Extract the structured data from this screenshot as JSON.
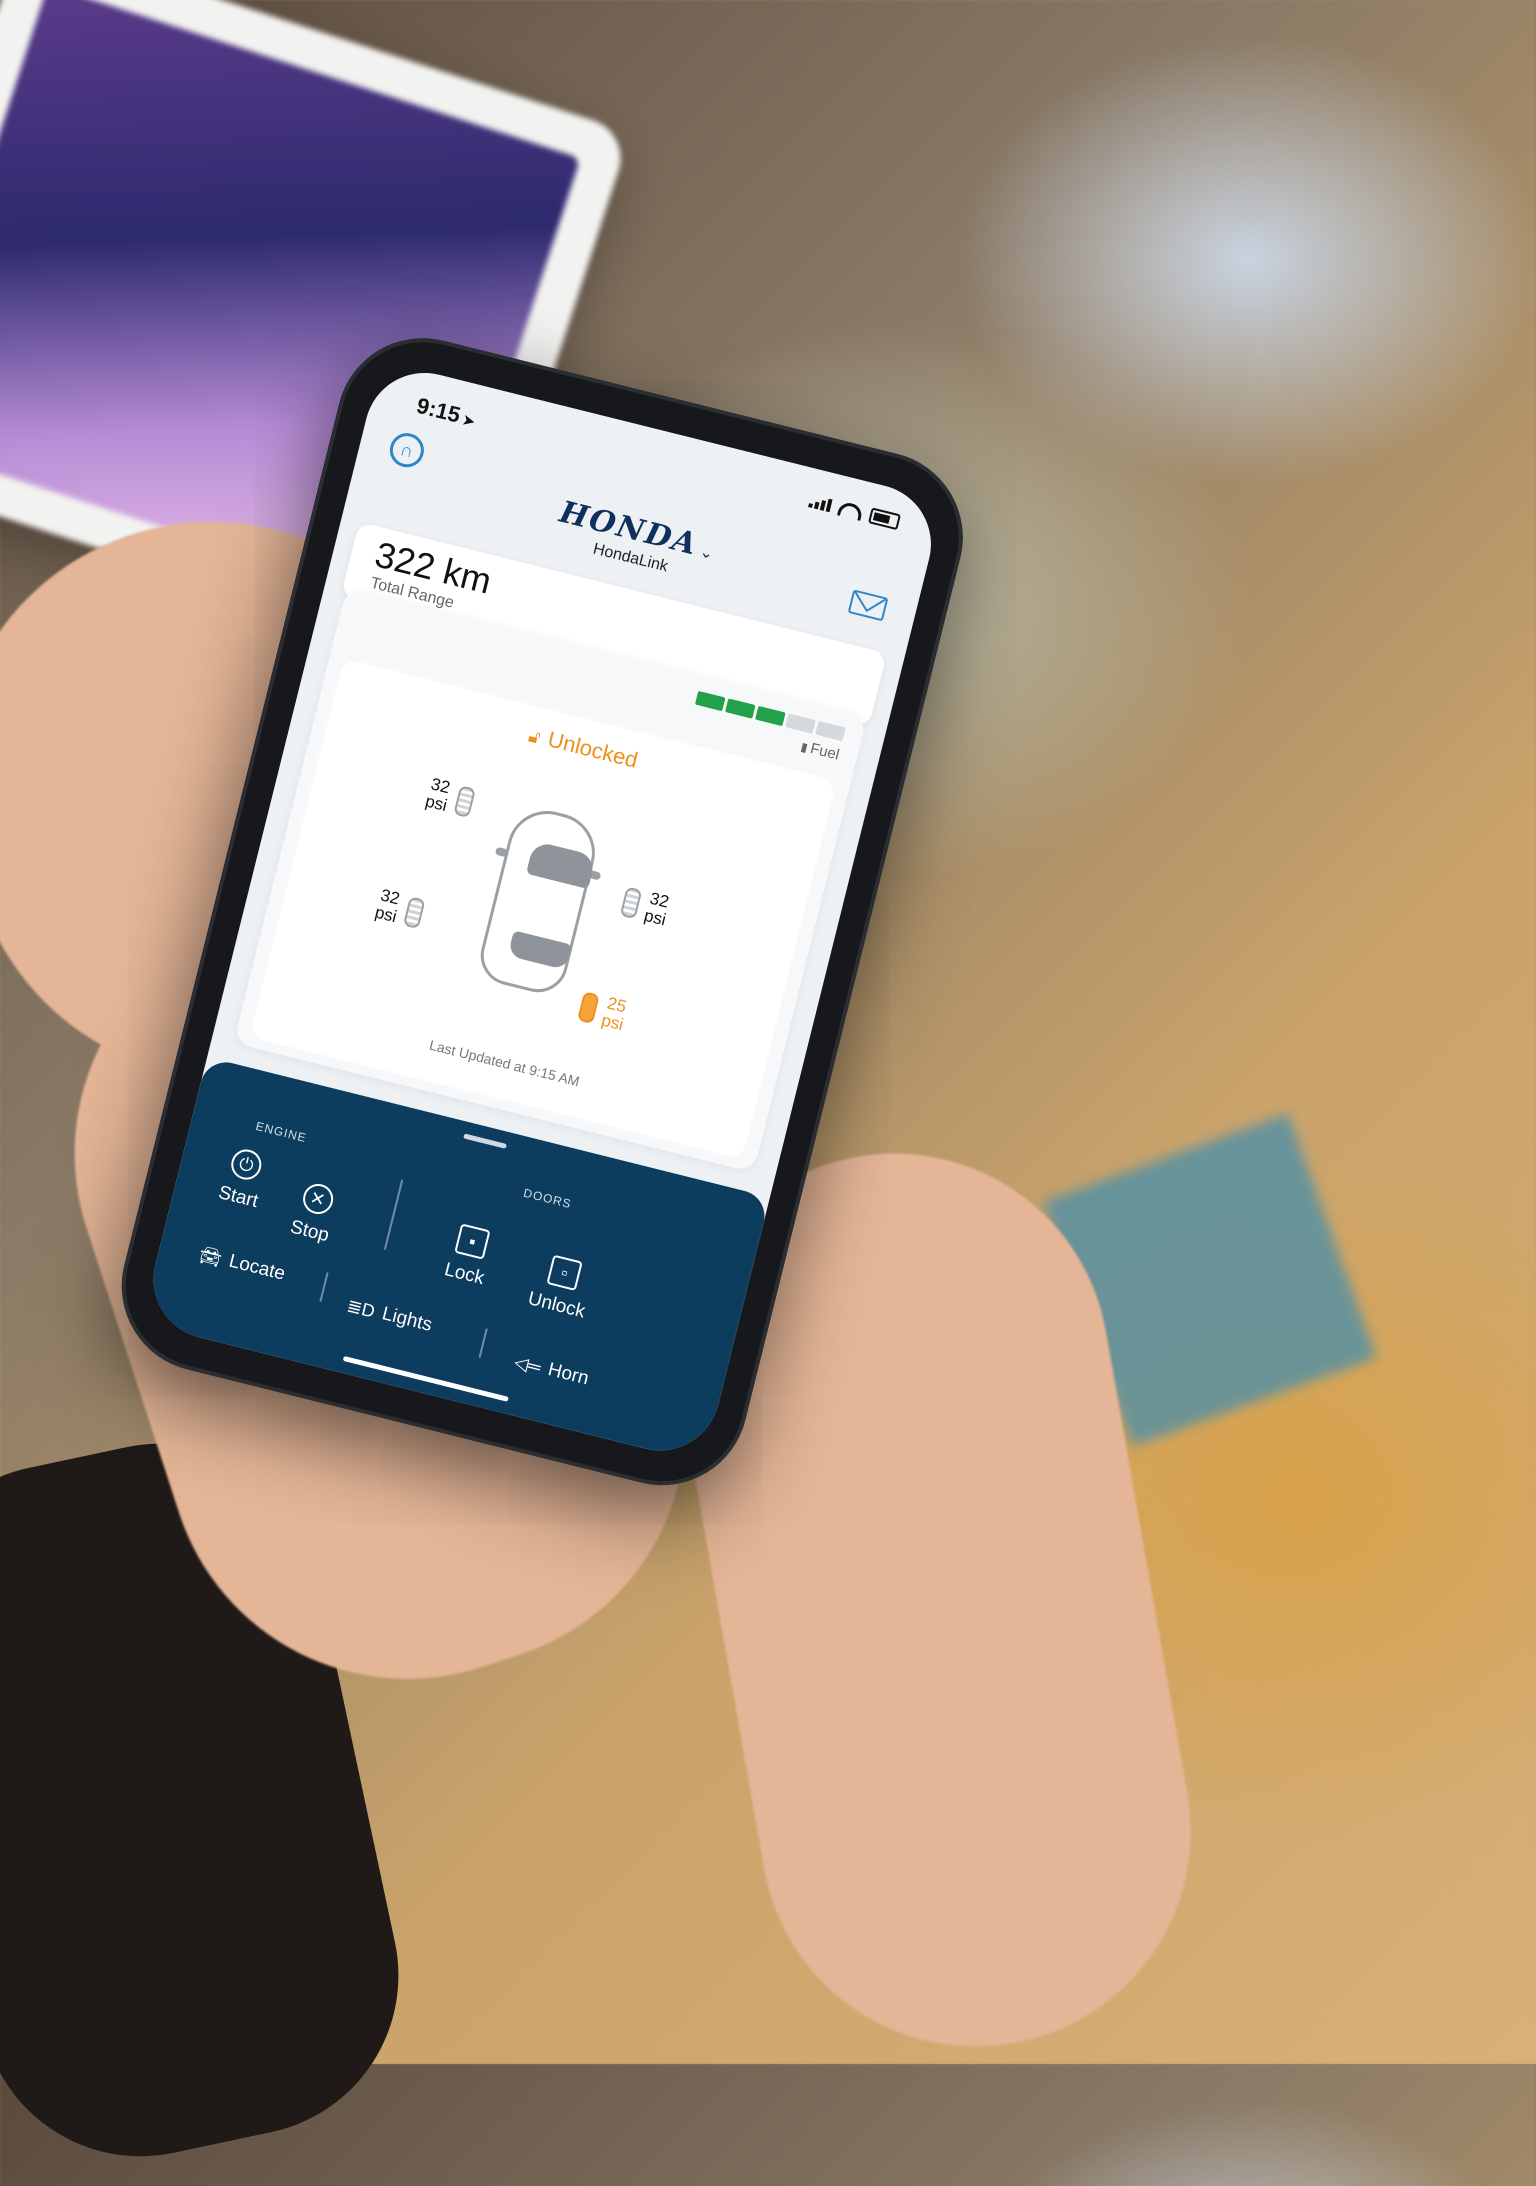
{
  "status_bar": {
    "time": "9:15"
  },
  "header": {
    "brand": "HONDA",
    "app_name": "HondaLink"
  },
  "range": {
    "value": "322 km",
    "label": "Total Range"
  },
  "fuel": {
    "label": "Fuel",
    "level_segments": 3,
    "total_segments": 5,
    "filled_color": "#22a04a",
    "empty_color": "#d6d9dc"
  },
  "vehicle": {
    "lock_status": "Unlocked",
    "lock_status_color": "#f0901c",
    "tires": {
      "front_left": {
        "value": "32",
        "unit": "psi"
      },
      "front_right": {
        "value": "32",
        "unit": "psi"
      },
      "rear_left": {
        "value": "32",
        "unit": "psi"
      },
      "rear_right": {
        "value": "25",
        "unit": "psi",
        "warning": true
      }
    },
    "last_updated": "Last Updated at 9:15 AM"
  },
  "controls": {
    "engine_label": "ENGINE",
    "doors_label": "DOORS",
    "start": "Start",
    "stop": "Stop",
    "lock": "Lock",
    "unlock": "Unlock",
    "locate": "Locate",
    "lights": "Lights",
    "horn": "Horn",
    "panel_color": "#0c3c5e"
  },
  "icons": [
    "profile-icon",
    "mail-icon",
    "lock-icon",
    "power-icon",
    "close-circle-icon",
    "car-icon",
    "headlight-icon",
    "horn-icon",
    "padlock-closed-icon",
    "padlock-open-icon"
  ]
}
